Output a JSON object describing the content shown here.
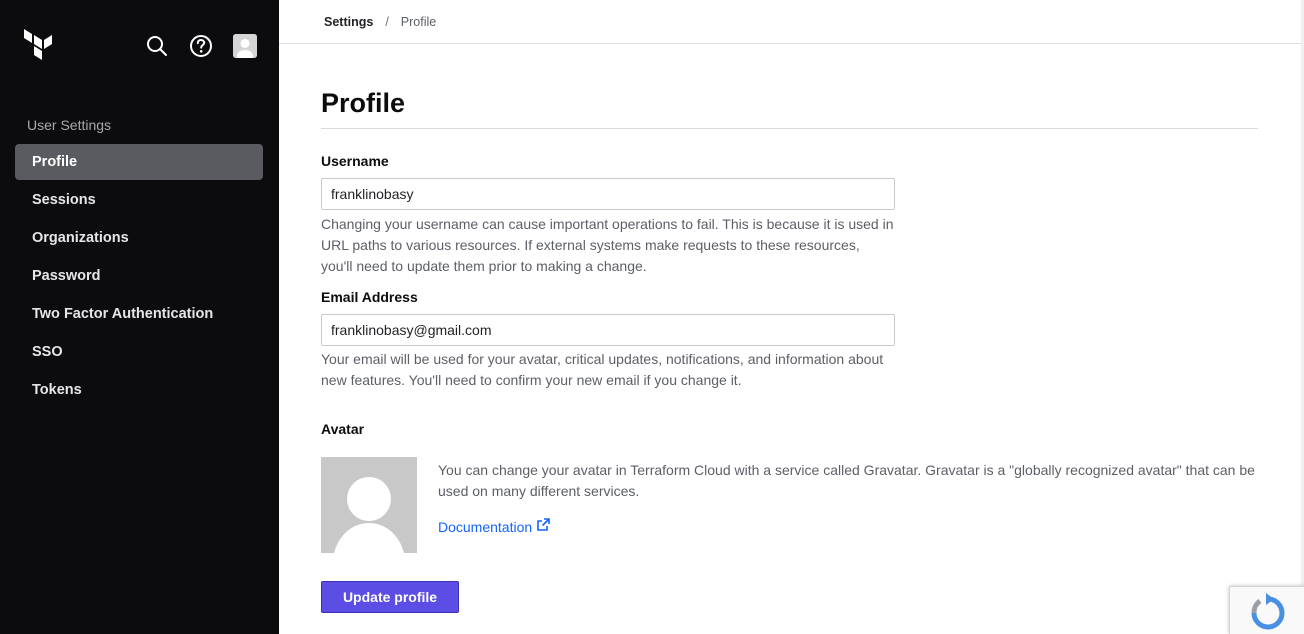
{
  "sidebar": {
    "section_title": "User Settings",
    "items": [
      {
        "label": "Profile",
        "active": true
      },
      {
        "label": "Sessions"
      },
      {
        "label": "Organizations"
      },
      {
        "label": "Password"
      },
      {
        "label": "Two Factor Authentication"
      },
      {
        "label": "SSO"
      },
      {
        "label": "Tokens"
      }
    ],
    "icons": [
      "terraform-logo-icon",
      "search-icon",
      "help-icon",
      "user-avatar-icon"
    ]
  },
  "breadcrumb": {
    "parent": "Settings",
    "separator": "/",
    "current": "Profile"
  },
  "main": {
    "title": "Profile",
    "username": {
      "label": "Username",
      "value": "franklinobasy",
      "help": "Changing your username can cause important operations to fail. This is because it is used in URL paths to various resources. If external systems make requests to these resources, you'll need to update them prior to making a change."
    },
    "email": {
      "label": "Email Address",
      "value": "franklinobasy@gmail.com",
      "help": "Your email will be used for your avatar, critical updates, notifications, and information about new features. You'll need to confirm your new email if you change it."
    },
    "avatar": {
      "label": "Avatar",
      "description": "You can change your avatar in Terraform Cloud with a service called Gravatar. Gravatar is a \"globally recognized avatar\" that can be used on many different services.",
      "link_label": "Documentation"
    },
    "submit_label": "Update profile"
  },
  "colors": {
    "sidebar_bg": "#0c0c0e",
    "active_item_bg": "#5a5b61",
    "primary_button": "#5c4ee5",
    "link": "#1563ff"
  }
}
